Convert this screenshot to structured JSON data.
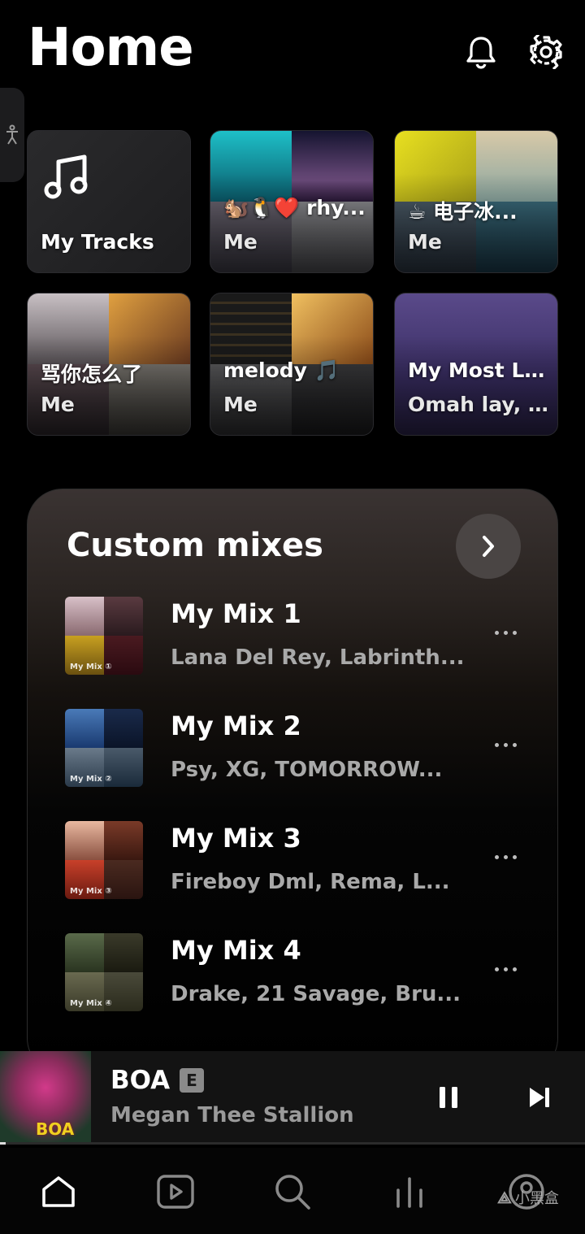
{
  "header": {
    "title": "Home"
  },
  "tiles": [
    {
      "title": "My Tracks",
      "subtitle": ""
    },
    {
      "title": "🐿️🐧❤️ rhy...",
      "subtitle": "Me"
    },
    {
      "title": "☕ 电子冰...",
      "subtitle": "Me"
    },
    {
      "title": "骂你怎么了",
      "subtitle": "Me"
    },
    {
      "title": "melody 🎵",
      "subtitle": "Me"
    },
    {
      "title": "My Most Li...",
      "subtitle": "Omah lay, ..."
    }
  ],
  "custom_mixes": {
    "title": "Custom mixes",
    "items": [
      {
        "name": "My Mix 1",
        "artists": "Lana Del Rey, Labrinth...",
        "art_label": "My Mix ①"
      },
      {
        "name": "My Mix 2",
        "artists": "Psy, XG, TOMORROW...",
        "art_label": "My Mix ②"
      },
      {
        "name": "My Mix 3",
        "artists": "Fireboy Dml, Rema, L...",
        "art_label": "My Mix ③"
      },
      {
        "name": "My Mix 4",
        "artists": "Drake, 21 Savage, Bru...",
        "art_label": "My Mix ④"
      }
    ]
  },
  "player": {
    "title": "BOA",
    "explicit": "E",
    "artist": "Megan Thee Stallion",
    "art_text": "BOA",
    "progress": 0.01
  },
  "nav": {
    "items": [
      "home-icon",
      "videos-icon",
      "search-icon",
      "stats-icon",
      "profile-icon"
    ]
  },
  "watermark": "小黑盒"
}
